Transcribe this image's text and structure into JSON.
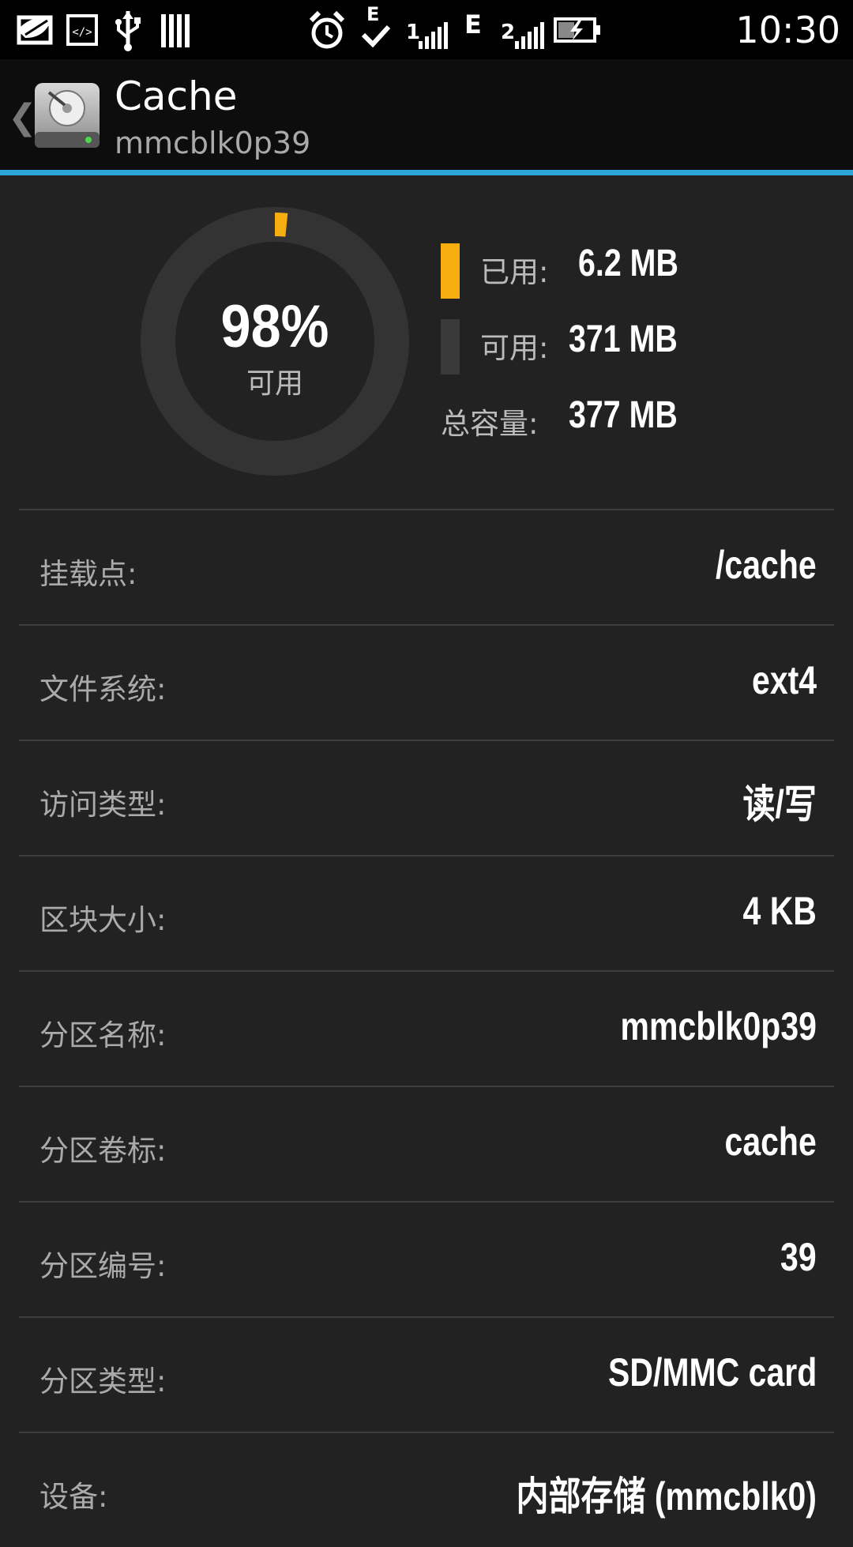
{
  "status_bar": {
    "time": "10:30",
    "icons": [
      "leaf-notification-icon",
      "developer-code-icon",
      "usb-icon",
      "sd-card-icon",
      "alarm-icon",
      "e-check-icon",
      "signal-1-icon",
      "e-network-icon",
      "signal-2-icon",
      "battery-charging-icon"
    ],
    "network_label_1": "E",
    "network_label_2": "E",
    "signal_label_1": "1",
    "signal_label_2": "2"
  },
  "action_bar": {
    "back_glyph": "❮",
    "title": "Cache",
    "subtitle": "mmcblk0p39",
    "accent_color": "#2fa6d9"
  },
  "usage": {
    "available_percent_text": "98%",
    "available_label": "可用",
    "used_fraction": 0.016,
    "used_color": "#f5ad0f",
    "track_color": "#333333",
    "legend": [
      {
        "label": "已用:",
        "value": "6.2 MB",
        "swatch_color": "#f5ad0f"
      },
      {
        "label": "可用:",
        "value": "371 MB",
        "swatch_color": "#3a3a3a"
      },
      {
        "label": "总容量:",
        "value": "377 MB",
        "swatch_color": ""
      }
    ]
  },
  "details": [
    {
      "label": "挂载点:",
      "value": "/cache"
    },
    {
      "label": "文件系统:",
      "value": "ext4"
    },
    {
      "label": "访问类型:",
      "value": "读/写"
    },
    {
      "label": "区块大小:",
      "value": "4 KB"
    },
    {
      "label": "分区名称:",
      "value": "mmcblk0p39"
    },
    {
      "label": "分区卷标:",
      "value": "cache"
    },
    {
      "label": "分区编号:",
      "value": "39"
    },
    {
      "label": "分区类型:",
      "value": "SD/MMC card"
    },
    {
      "label": "设备:",
      "value": "内部存储 (mmcblk0)"
    }
  ]
}
